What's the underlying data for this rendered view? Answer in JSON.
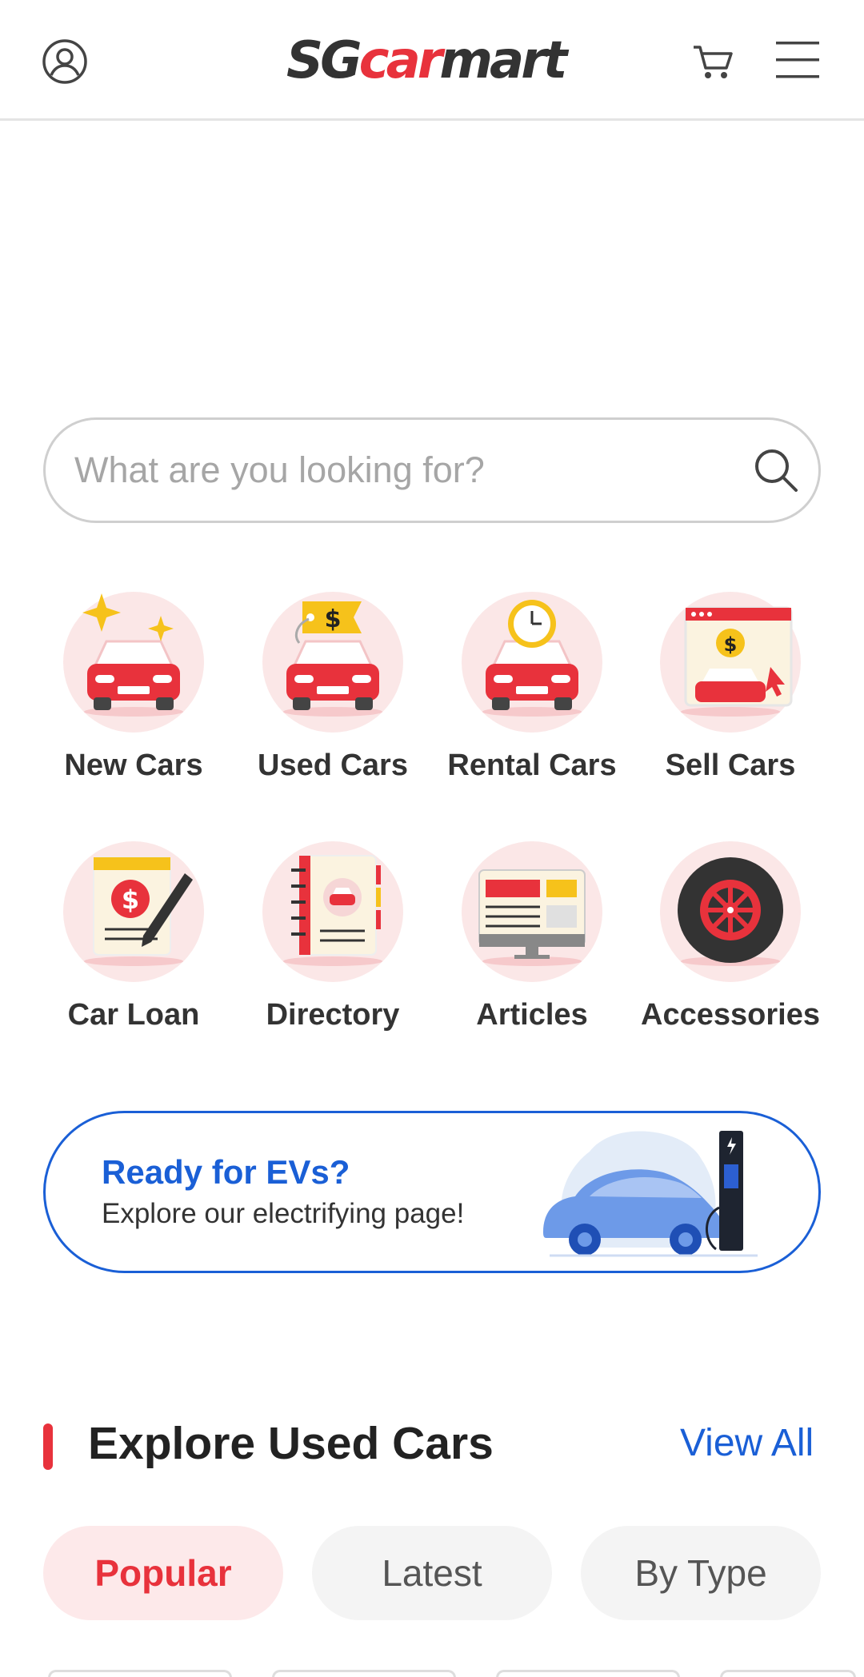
{
  "header": {
    "logo_sg": "SG",
    "logo_car": "car",
    "logo_mart": "mart",
    "profile_icon": "user-circle-icon",
    "cart_icon": "cart-icon",
    "menu_icon": "hamburger-menu-icon"
  },
  "search": {
    "placeholder": "What are you looking for?",
    "value": "",
    "icon": "search-icon"
  },
  "categories": [
    {
      "label": "New Cars",
      "icon": "new-car-icon"
    },
    {
      "label": "Used Cars",
      "icon": "used-car-icon"
    },
    {
      "label": "Rental Cars",
      "icon": "rental-car-icon"
    },
    {
      "label": "Sell Cars",
      "icon": "sell-car-icon"
    },
    {
      "label": "Car Loan",
      "icon": "car-loan-icon"
    },
    {
      "label": "Directory",
      "icon": "directory-icon"
    },
    {
      "label": "Articles",
      "icon": "articles-icon"
    },
    {
      "label": "Accessories",
      "icon": "accessories-icon"
    }
  ],
  "ev_banner": {
    "title": "Ready for EVs?",
    "subtitle": "Explore our electrifying page!"
  },
  "used_cars_section": {
    "title": "Explore Used Cars",
    "view_all": "View All",
    "tabs": [
      {
        "label": "Popular",
        "active": true
      },
      {
        "label": "Latest",
        "active": false
      },
      {
        "label": "By Type",
        "active": false
      }
    ]
  },
  "colors": {
    "brand_red": "#e8323c",
    "accent_blue": "#1a5fd6",
    "icon_bg": "#fbe7e7"
  }
}
